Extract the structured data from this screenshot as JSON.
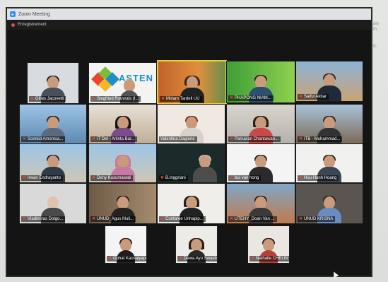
{
  "window": {
    "title": "Zoom Meeting",
    "recording_label": "Enregistrement",
    "side_text": "alo\nth\n\n\nfc"
  },
  "participants": [
    {
      "name": "Gilles Jacovetti",
      "muted": true
    },
    {
      "name": "Siegfried Rouvrais (I...",
      "muted": true
    },
    {
      "name": "Miriam Tardell UU",
      "muted": true,
      "active_speaker": true
    },
    {
      "name": "PHAPONG NIAM...",
      "muted": true
    },
    {
      "name": "Saiful Akbar",
      "muted": true
    },
    {
      "name": "Somkid Amornsa...",
      "muted": true
    },
    {
      "name": "IT Del - Arlinta Bar...",
      "muted": true
    },
    {
      "name": "Valentina Dagiene",
      "muted": false
    },
    {
      "name": "Panuwan Chantawan...",
      "muted": true
    },
    {
      "name": "ITB - Muhammad...",
      "muted": true
    },
    {
      "name": "Irwan Endrayanto",
      "muted": true
    },
    {
      "name": "Deny Kusumawati",
      "muted": true
    },
    {
      "name": "B.Inggriani",
      "muted": true
    },
    {
      "name": "bui van hong",
      "muted": true
    },
    {
      "name": "Huu Hanh Hoang",
      "muted": true
    },
    {
      "name": "Vladimiras Dolgo...",
      "muted": true
    },
    {
      "name": "UNUD_Agus Muli...",
      "muted": true
    },
    {
      "name": "Cuntaree Unhapip...",
      "muted": true
    },
    {
      "name": "UTEHY_Doan Van ...",
      "muted": true
    },
    {
      "name": "UNUD KRISNA",
      "muted": true
    },
    {
      "name": "Ophat Kaosaiyapo...",
      "muted": true
    },
    {
      "name": "Dewa Ayu Swastini",
      "muted": true
    },
    {
      "name": "Nathalie CHELIN -...",
      "muted": true
    }
  ],
  "logos": {
    "asten": "ASTEN"
  },
  "colors": {
    "active_border": "#e6d229",
    "muted_icon": "#e0483a",
    "zoom_blue": "#2d8cff"
  }
}
